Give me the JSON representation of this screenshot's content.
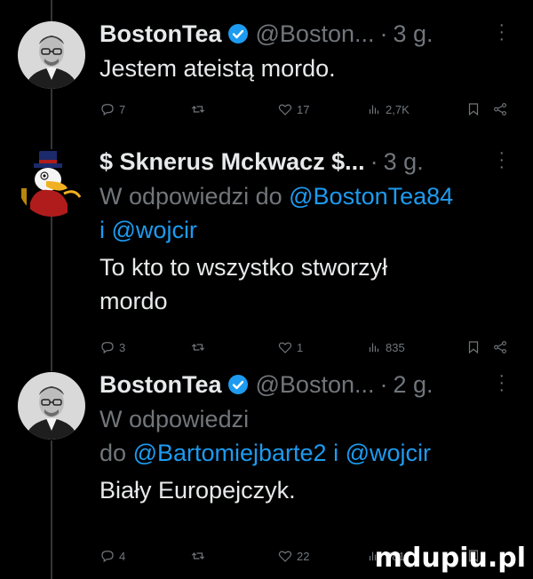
{
  "tweets": [
    {
      "name": "BostonTea",
      "handle": "@Boston...",
      "time": "3 g.",
      "text": "Jestem ateistą mordo.",
      "replies": "7",
      "retweets": "",
      "likes": "17",
      "views": "2,7K",
      "avatar": "portrait-man-glasses"
    },
    {
      "name": "$ Sknerus Mckwacz $...",
      "handle": "",
      "time": "3 g.",
      "reply_to_prefix": "W odpowiedzi do",
      "reply_to_1": "@BostonTea84",
      "reply_to_joiner": "i",
      "reply_to_2": "@wojcir",
      "text_line1": "To kto to wszystko stworzył",
      "text_line2": "mordo",
      "replies": "3",
      "retweets": "",
      "likes": "1",
      "views": "835",
      "avatar": "cartoon-duck-top-hat"
    },
    {
      "name": "BostonTea",
      "handle": "@Boston...",
      "time": "2 g.",
      "reply_to_prefix_1": "W odpowiedzi",
      "reply_to_prefix_2": "do",
      "reply_to_1": "@Bartomiejbarte2",
      "reply_to_joiner": "i",
      "reply_to_2": "@wojcir",
      "text": "Biały Europejczyk.",
      "replies": "4",
      "retweets": "",
      "likes": "22",
      "views": "781",
      "avatar": "portrait-man-glasses"
    }
  ],
  "watermark": "mdupiu.pl",
  "colors": {
    "background": "#000000",
    "text": "#e7e9ea",
    "muted": "#71767b",
    "link": "#1d9bf0",
    "verified": "#1d9bf0"
  },
  "icons": [
    "reply-icon",
    "retweet-icon",
    "like-icon",
    "views-icon",
    "bookmark-icon",
    "share-icon",
    "verified-badge-icon",
    "more-icon"
  ]
}
